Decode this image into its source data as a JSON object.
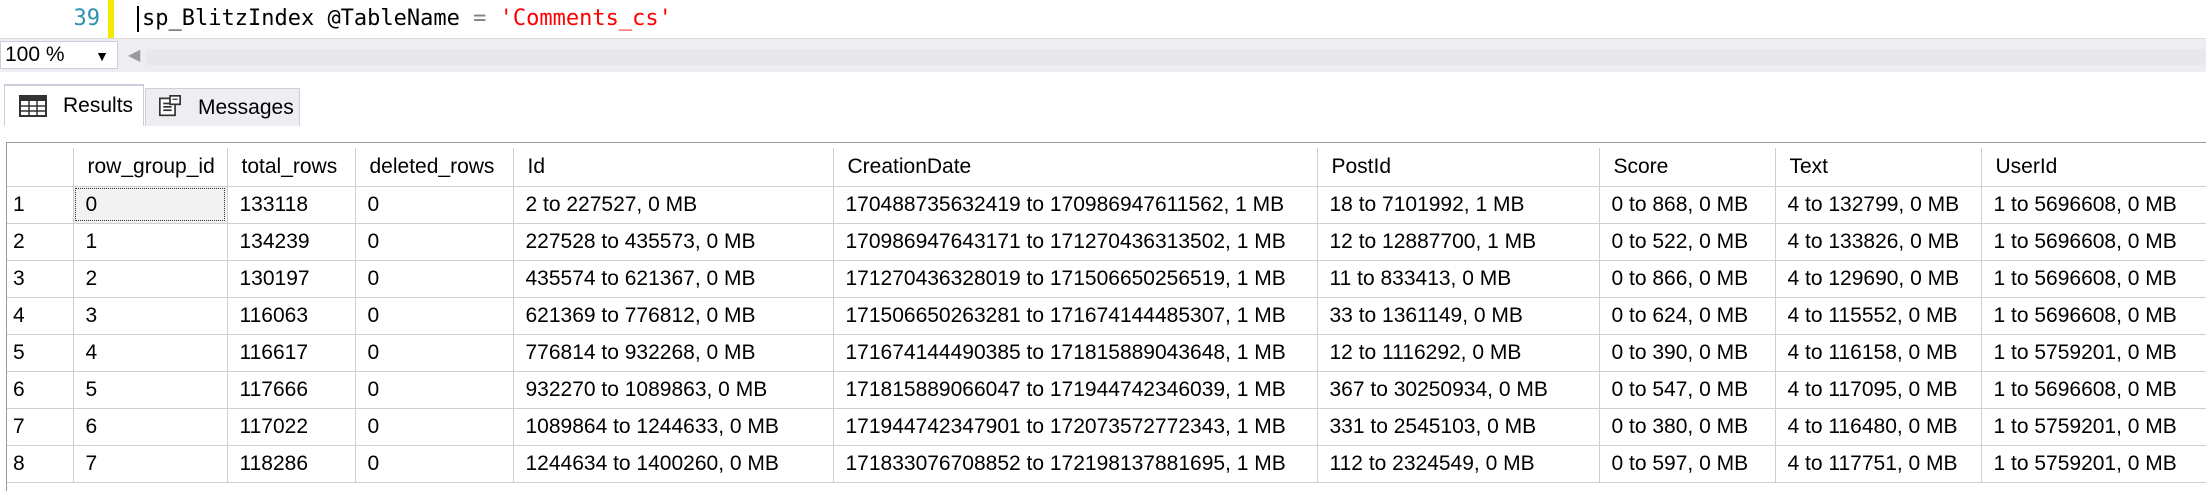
{
  "editor": {
    "line_number": "39",
    "code_proc": "sp_BlitzIndex",
    "code_param": "@TableName",
    "code_op": "=",
    "code_string": "'Comments_cs'"
  },
  "zoom": {
    "value": "100 %"
  },
  "tabs": [
    {
      "label": "Results",
      "icon": "grid-icon",
      "active": true
    },
    {
      "label": "Messages",
      "icon": "messages-icon",
      "active": false
    }
  ],
  "grid": {
    "columns": [
      "",
      "row_group_id",
      "total_rows",
      "deleted_rows",
      "Id",
      "CreationDate",
      "PostId",
      "Score",
      "Text",
      "UserId"
    ],
    "rows": [
      [
        "1",
        "0",
        "133118",
        "0",
        "2 to 227527, 0 MB",
        "170488735632419 to 170986947611562, 1 MB",
        "18 to 7101992, 1 MB",
        "0 to 868, 0 MB",
        "4 to 132799, 0 MB",
        "1 to 5696608, 0 MB"
      ],
      [
        "2",
        "1",
        "134239",
        "0",
        "227528 to 435573, 0 MB",
        "170986947643171 to 171270436313502, 1 MB",
        "12 to 12887700, 1 MB",
        "0 to 522, 0 MB",
        "4 to 133826, 0 MB",
        "1 to 5696608, 0 MB"
      ],
      [
        "3",
        "2",
        "130197",
        "0",
        "435574 to 621367, 0 MB",
        "171270436328019 to 171506650256519, 1 MB",
        "11 to 833413, 0 MB",
        "0 to 866, 0 MB",
        "4 to 129690, 0 MB",
        "1 to 5696608, 0 MB"
      ],
      [
        "4",
        "3",
        "116063",
        "0",
        "621369 to 776812, 0 MB",
        "171506650263281 to 171674144485307, 1 MB",
        "33 to 1361149, 0 MB",
        "0 to 624, 0 MB",
        "4 to 115552, 0 MB",
        "1 to 5696608, 0 MB"
      ],
      [
        "5",
        "4",
        "116617",
        "0",
        "776814 to 932268, 0 MB",
        "171674144490385 to 171815889043648, 1 MB",
        "12 to 1116292, 0 MB",
        "0 to 390, 0 MB",
        "4 to 116158, 0 MB",
        "1 to 5759201, 0 MB"
      ],
      [
        "6",
        "5",
        "117666",
        "0",
        "932270 to 1089863, 0 MB",
        "171815889066047 to 171944742346039, 1 MB",
        "367 to 30250934, 0 MB",
        "0 to 547, 0 MB",
        "4 to 117095, 0 MB",
        "1 to 5696608, 0 MB"
      ],
      [
        "7",
        "6",
        "117022",
        "0",
        "1089864 to 1244633, 0 MB",
        "171944742347901 to 172073572772343, 1 MB",
        "331 to 2545103, 0 MB",
        "0 to 380, 0 MB",
        "4 to 116480, 0 MB",
        "1 to 5759201, 0 MB"
      ],
      [
        "8",
        "7",
        "118286",
        "0",
        "1244634 to 1400260, 0 MB",
        "171833076708852 to 172198137881695, 1 MB",
        "112 to 2324549, 0 MB",
        "0 to 597, 0 MB",
        "4 to 117751, 0 MB",
        "1 to 5759201, 0 MB"
      ]
    ]
  }
}
